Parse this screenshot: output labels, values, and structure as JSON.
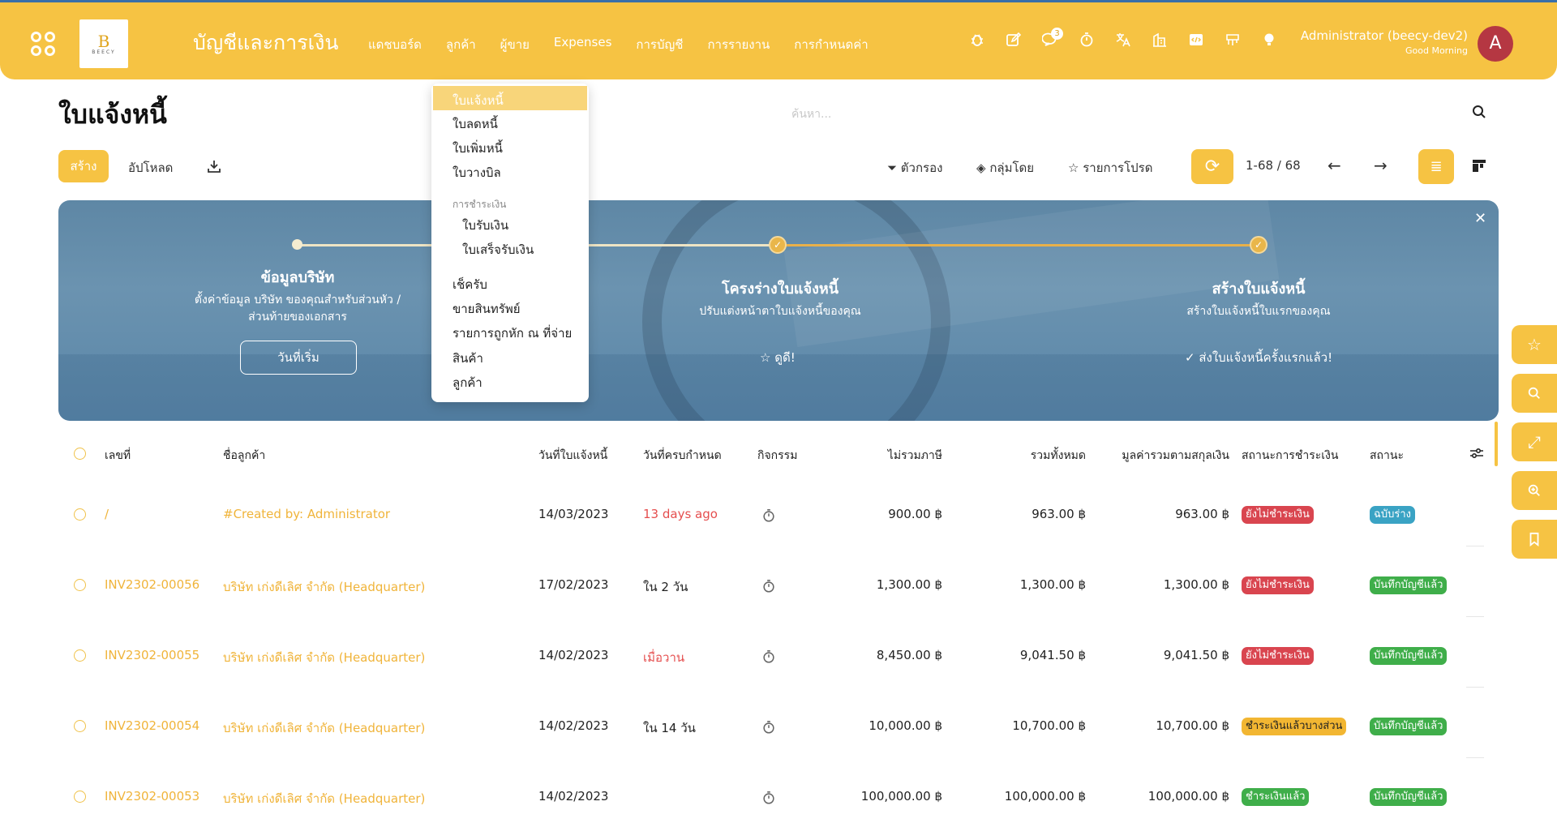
{
  "app": {
    "title": "บัญชีและการเงิน",
    "logo_text": "BEECY",
    "nav": [
      "แดชบอร์ด",
      "ลูกค้า",
      "ผู้ขาย",
      "Expenses",
      "การบัญชี",
      "การรายงาน",
      "การกำหนดค่า"
    ],
    "chat_badge": "3",
    "user_name": "Administrator (beecy-dev2)",
    "greeting": "Good Morning",
    "avatar_letter": "A",
    "icons": [
      "bug-icon",
      "edit-icon",
      "chat-icon",
      "stopwatch-icon",
      "translate-icon",
      "building-icon",
      "code-icon",
      "megaphone-icon",
      "lightbulb-icon"
    ]
  },
  "page": {
    "title": "ใบแจ้งหนี้",
    "search_placeholder": "ค้นหา...",
    "create_label": "สร้าง",
    "upload_label": "อัปโหลด",
    "filter_label": "ตัวกรอง",
    "group_label": "กลุ่มโดย",
    "favorite_label": "รายการโปรด",
    "pager": "1-68 / 68"
  },
  "dropdown": {
    "active": "ใบแจ้งหนี้",
    "items": [
      "ใบลดหนี้",
      "ใบเพิ่มหนี้",
      "ใบวางบิล"
    ],
    "section": "การชำระเงิน",
    "sub_items": [
      "ใบรับเงิน",
      "ใบเสร็จรับเงิน"
    ],
    "more_items": [
      "เช็ครับ",
      "ขายสินทรัพย์",
      "รายการถูกหัก ณ ที่จ่าย",
      "สินค้า",
      "ลูกค้า"
    ]
  },
  "banner": {
    "step1_title": "ข้อมูลบริษัท",
    "step1_desc_1": "ตั้งค่าข้อมูล บริษัท ของคุณสำหรับส่วนหัว /",
    "step1_desc_2": "ส่วนท้ายของเอกสาร",
    "step1_button": "วันที่เริ่ม",
    "step2_title": "โครงร่างใบแจ้งหนี้",
    "step2_desc": "ปรับแต่งหน้าตาใบแจ้งหนี้ของคุณ",
    "step2_link": "☆ ดูดี!",
    "step3_title": "สร้างใบแจ้งหนี้",
    "step3_desc": "สร้างใบแจ้งหนี้ใบแรกของคุณ",
    "step3_link": "✓ ส่งใบแจ้งหนี้ครั้งแรกแล้ว!"
  },
  "table": {
    "headers": [
      "เลขที่",
      "ชื่อลูกค้า",
      "วันที่ใบแจ้งหนี้",
      "วันที่ครบกำหนด",
      "กิจกรรม",
      "ไม่รวมภาษี",
      "รวมทั้งหมด",
      "มูลค่ารวมตามสกุลเงิน",
      "สถานะการชำระเงิน",
      "สถานะ"
    ],
    "rows": [
      {
        "number": "/",
        "customer": "#Created by: Administrator",
        "date": "14/03/2023",
        "due": "13 days ago",
        "due_red": true,
        "untaxed": "900.00 ฿",
        "total": "963.00 ฿",
        "total_currency": "963.00 ฿",
        "payment": "ยังไม่ชำระเงิน",
        "payment_color": "#d9454f",
        "status": "ฉบับร่าง",
        "status_color": "#3aa3c4"
      },
      {
        "number": "INV2302-00056",
        "customer": "บริษัท เก่งดีเลิศ จำกัด (Headquarter)",
        "date": "17/02/2023",
        "due": "ใน 2 วัน",
        "due_red": false,
        "untaxed": "1,300.00 ฿",
        "total": "1,300.00 ฿",
        "total_currency": "1,300.00 ฿",
        "payment": "ยังไม่ชำระเงิน",
        "payment_color": "#d9454f",
        "status": "บันทึกบัญชีแล้ว",
        "status_color": "#3fae4a"
      },
      {
        "number": "INV2302-00055",
        "customer": "บริษัท เก่งดีเลิศ จำกัด (Headquarter)",
        "date": "14/02/2023",
        "due": "เมื่อวาน",
        "due_red": true,
        "untaxed": "8,450.00 ฿",
        "total": "9,041.50 ฿",
        "total_currency": "9,041.50 ฿",
        "payment": "ยังไม่ชำระเงิน",
        "payment_color": "#d9454f",
        "status": "บันทึกบัญชีแล้ว",
        "status_color": "#3fae4a"
      },
      {
        "number": "INV2302-00054",
        "customer": "บริษัท เก่งดีเลิศ จำกัด (Headquarter)",
        "date": "14/02/2023",
        "due": "ใน 14 วัน",
        "due_red": false,
        "untaxed": "10,000.00 ฿",
        "total": "10,700.00 ฿",
        "total_currency": "10,700.00 ฿",
        "payment": "ชำระเงินแล้วบางส่วน",
        "payment_color": "#f2b632",
        "payment_text_dark": true,
        "status": "บันทึกบัญชีแล้ว",
        "status_color": "#3fae4a"
      },
      {
        "number": "INV2302-00053",
        "customer": "บริษัท เก่งดีเลิศ จำกัด (Headquarter)",
        "date": "14/02/2023",
        "due": "",
        "due_red": false,
        "untaxed": "100,000.00 ฿",
        "total": "100,000.00 ฿",
        "total_currency": "100,000.00 ฿",
        "payment": "ชำระเงินแล้ว",
        "payment_color": "#3fae4a",
        "status": "บันทึกบัญชีแล้ว",
        "status_color": "#3fae4a"
      }
    ]
  },
  "fab_icons": [
    "star-icon",
    "search-icon",
    "expand-icon",
    "zoom-in-icon",
    "bookmark-icon"
  ],
  "colors": {
    "accent": "#f6c343",
    "link": "#f0b43a",
    "danger": "#e54e4e"
  }
}
